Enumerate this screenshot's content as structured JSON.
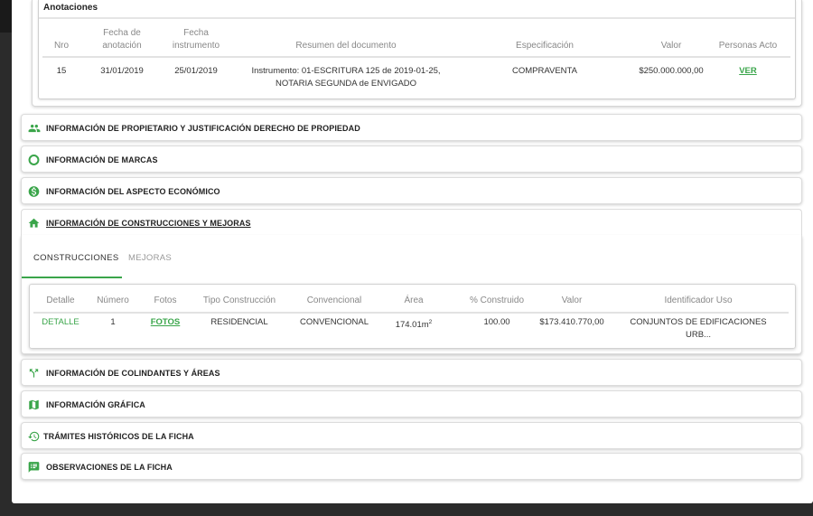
{
  "annotations": {
    "title": "Anotaciones",
    "headers": {
      "nro": "Nro",
      "fecha_anotacion_1": "Fecha de",
      "fecha_anotacion_2": "anotación",
      "fecha_instrumento_1": "Fecha",
      "fecha_instrumento_2": "instrumento",
      "resumen": "Resumen del documento",
      "especificacion": "Especificación",
      "valor": "Valor",
      "personas": "Personas Acto"
    },
    "rows": [
      {
        "nro": "15",
        "fecha_anotacion": "31/01/2019",
        "fecha_instrumento": "25/01/2019",
        "resumen_1": "Instrumento: 01-ESCRITURA 125 de 2019-01-25,",
        "resumen_2": "NOTARIA SEGUNDA de ENVIGADO",
        "especificacion": "COMPRAVENTA",
        "valor": "$250.000.000,00",
        "personas_link": "VER"
      }
    ]
  },
  "sections": {
    "propietario": {
      "label": "INFORMACIÓN DE PROPIETARIO Y JUSTIFICACIÓN DERECHO DE PROPIEDAD",
      "icon": "people-icon"
    },
    "marcas": {
      "label": "INFORMACIÓN DE MARCAS",
      "icon": "circle-outline-icon"
    },
    "economico": {
      "label": "INFORMACIÓN DEL ASPECTO ECONÓMICO",
      "icon": "dollar-circle-icon"
    },
    "construcciones": {
      "label": "INFORMACIÓN DE CONSTRUCCIONES Y MEJORAS",
      "icon": "home-icon"
    },
    "colindantes": {
      "label": "INFORMACIÓN DE COLINDANTES Y ÁREAS",
      "icon": "call-split-icon"
    },
    "grafica": {
      "label": "INFORMACIÓN GRÁFICA",
      "icon": "map-icon"
    },
    "tramites": {
      "label": "TRÁMITES HISTÓRICOS DE LA FICHA",
      "icon": "history-icon"
    },
    "observaciones": {
      "label": "OBSERVACIONES DE LA FICHA",
      "icon": "comment-icon"
    }
  },
  "construcciones": {
    "tabs": [
      "CONSTRUCCIONES",
      "MEJORAS"
    ],
    "headers": {
      "detalle": "Detalle",
      "numero": "Número",
      "fotos": "Fotos",
      "tipo": "Tipo Construcción",
      "convencional": "Convencional",
      "area": "Área",
      "construido": "% Construido",
      "valor": "Valor",
      "identificador": "Identificador Uso"
    },
    "rows": [
      {
        "detalle": "DETALLE",
        "numero": "1",
        "fotos": "FOTOS",
        "tipo": "RESIDENCIAL",
        "convencional": "CONVENCIONAL",
        "area": "174.01m",
        "area_sup": "2",
        "construido": "100.00",
        "valor": "$173.410.770,00",
        "identificador_1": "CONJUNTOS DE EDIFICACIONES",
        "identificador_2": "URB..."
      }
    ]
  },
  "colors": {
    "accent": "#3aa54a",
    "text": "#222222",
    "muted": "#888888"
  }
}
